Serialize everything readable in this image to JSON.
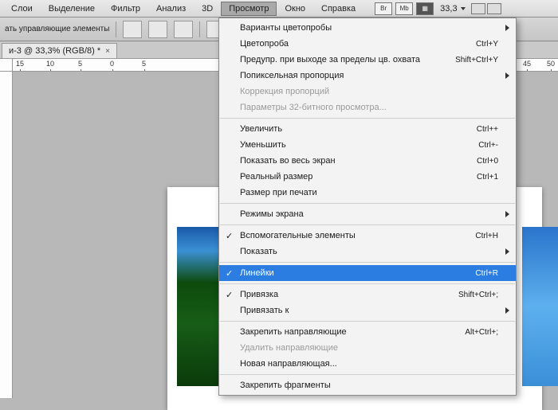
{
  "menubar": {
    "items": [
      "Слои",
      "Выделение",
      "Фильтр",
      "Анализ",
      "3D",
      "Просмотр",
      "Окно",
      "Справка"
    ],
    "open_index": 5,
    "badges": [
      "Br",
      "Mb"
    ],
    "zoom": "33,3"
  },
  "optbar": {
    "label": "ать управляющие элементы"
  },
  "tab": {
    "title": "и-3 @ 33,3% (RGB/8) *",
    "close": "×"
  },
  "ruler": {
    "marks": [
      "15",
      "10",
      "5",
      "0",
      "5"
    ],
    "right_marks": [
      "45",
      "50"
    ]
  },
  "menu": {
    "sections": [
      [
        {
          "label": "Варианты цветопробы",
          "sub": true
        },
        {
          "label": "Цветопроба",
          "acc": "Ctrl+Y"
        },
        {
          "label": "Предупр. при выходе за пределы цв. охвата",
          "acc": "Shift+Ctrl+Y"
        },
        {
          "label": "Попиксельная пропорция",
          "sub": true
        },
        {
          "label": "Коррекция пропорций",
          "dis": true
        },
        {
          "label": "Параметры 32-битного просмотра...",
          "dis": true
        }
      ],
      [
        {
          "label": "Увеличить",
          "acc": "Ctrl++"
        },
        {
          "label": "Уменьшить",
          "acc": "Ctrl+-"
        },
        {
          "label": "Показать во весь экран",
          "acc": "Ctrl+0"
        },
        {
          "label": "Реальный размер",
          "acc": "Ctrl+1"
        },
        {
          "label": "Размер при печати"
        }
      ],
      [
        {
          "label": "Режимы экрана",
          "sub": true
        }
      ],
      [
        {
          "label": "Вспомогательные элементы",
          "acc": "Ctrl+H",
          "ck": true
        },
        {
          "label": "Показать",
          "sub": true
        }
      ],
      [
        {
          "label": "Линейки",
          "acc": "Ctrl+R",
          "ck": true,
          "hl": true
        }
      ],
      [
        {
          "label": "Привязка",
          "acc": "Shift+Ctrl+;",
          "ck": true
        },
        {
          "label": "Привязать к",
          "sub": true
        }
      ],
      [
        {
          "label": "Закрепить направляющие",
          "acc": "Alt+Ctrl+;"
        },
        {
          "label": "Удалить направляющие",
          "dis": true
        },
        {
          "label": "Новая направляющая..."
        }
      ],
      [
        {
          "label": "Закрепить фрагменты"
        }
      ]
    ]
  }
}
